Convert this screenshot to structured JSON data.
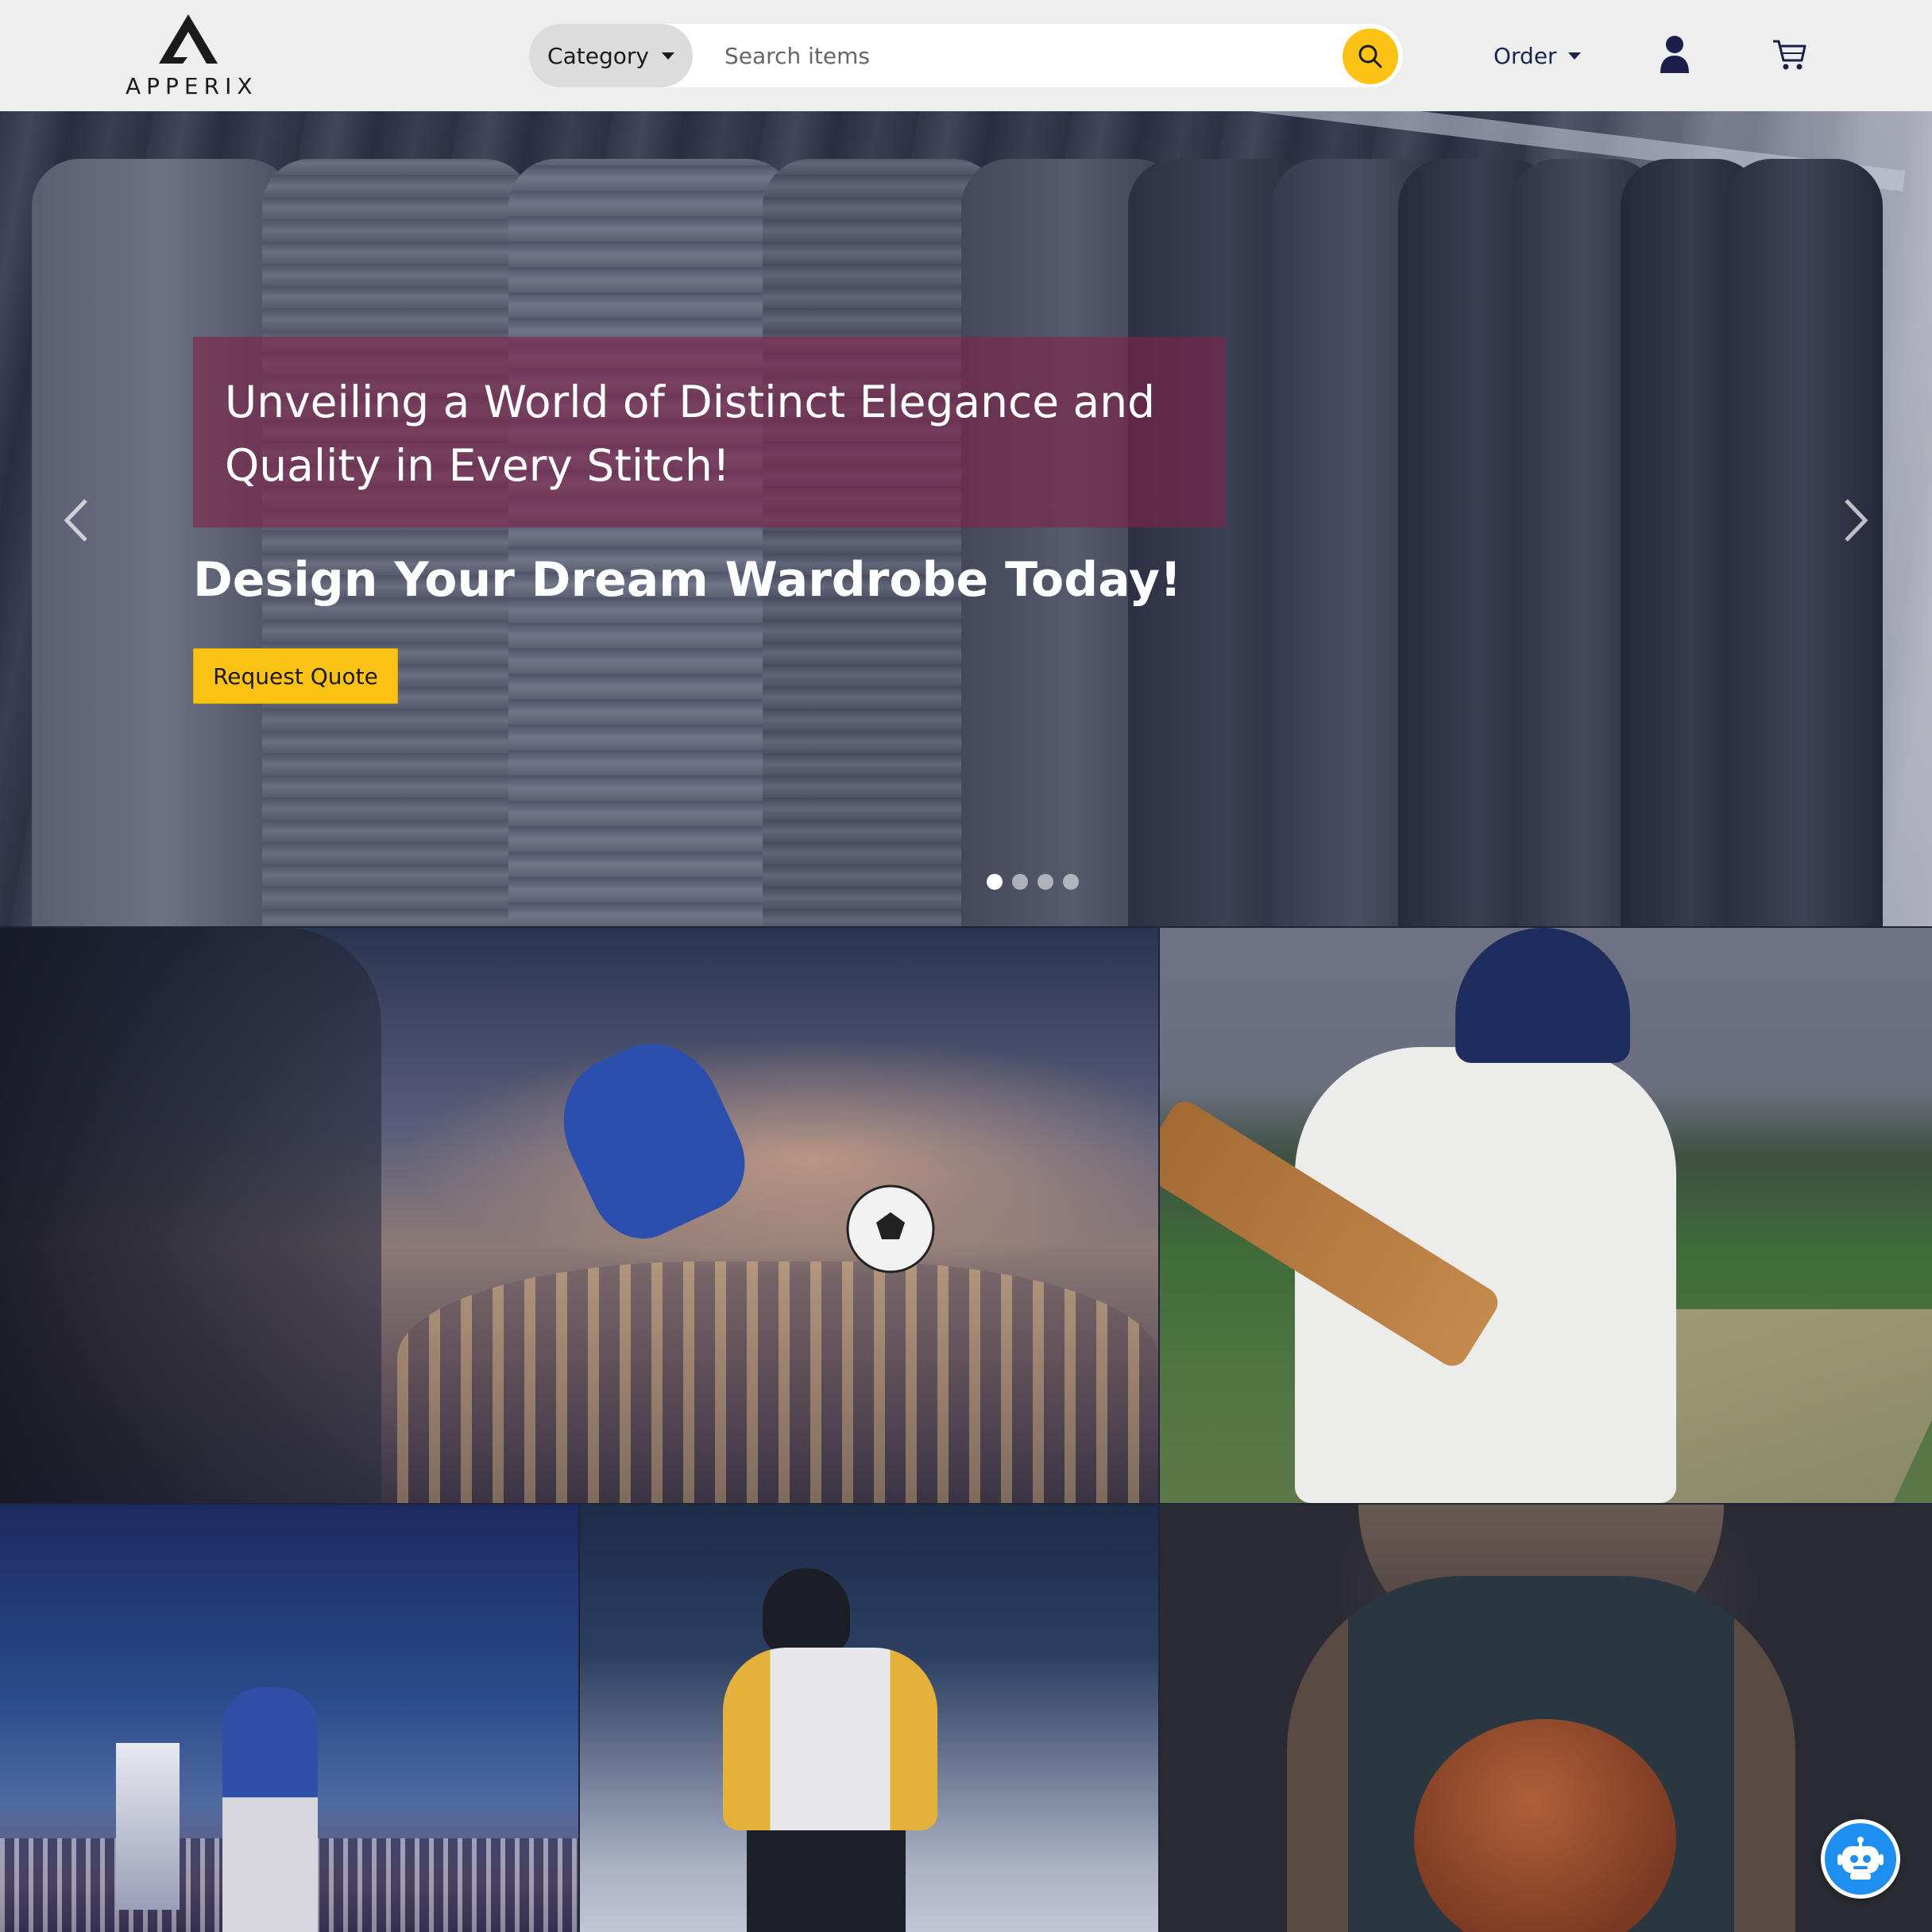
{
  "brand": {
    "name": "APPERIX"
  },
  "search": {
    "category_label": "Category",
    "placeholder": "Search items"
  },
  "nav": {
    "order_label": "Order"
  },
  "hero": {
    "caption": "Unveiling a World of Distinct Elegance and Quality in Every Stitch!",
    "title": "Design Your Dream Wardrobe Today!",
    "cta_label": "Request Quote",
    "slides_count": 4,
    "active_slide": 1
  },
  "tiles": [
    {
      "name": "soccer"
    },
    {
      "name": "cricket"
    },
    {
      "name": "baseball"
    },
    {
      "name": "hockey"
    },
    {
      "name": "basketball"
    }
  ],
  "colors": {
    "accent": "#fcc314",
    "caption_bg": "#80244b",
    "navbar_bg": "#eeeeee",
    "nav_text": "#1a2550",
    "chat": "#1e8ff0"
  },
  "icons": [
    "search-icon",
    "user-icon",
    "cart-icon",
    "chevron-left-icon",
    "chevron-right-icon",
    "chatbot-icon"
  ]
}
